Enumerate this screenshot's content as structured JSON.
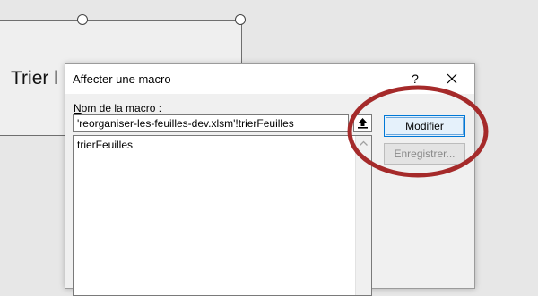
{
  "shape": {
    "text": "Trier l"
  },
  "dialog": {
    "title": "Affecter une macro",
    "help_label": "?",
    "macro_name_label": "Nom de la macro :",
    "macro_name_value": "'reorganiser-les-feuilles-dev.xlsm'!trierFeuilles",
    "macro_list": [
      "trierFeuilles"
    ],
    "buttons": {
      "modify": "Modifier",
      "record": "Enregistrer..."
    }
  },
  "annotation": {
    "color": "#a52a2a"
  }
}
